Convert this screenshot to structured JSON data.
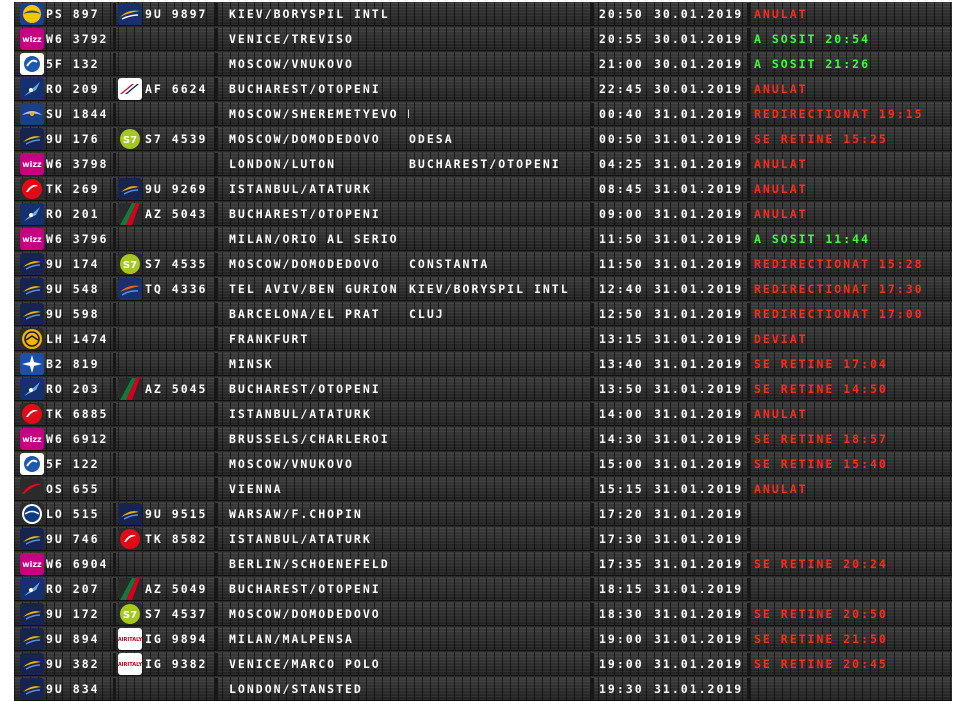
{
  "colors": {
    "board": "#2b2b2b",
    "text": "#ffffff",
    "delay": "#ff2a1a",
    "landed": "#3cff3c"
  },
  "flights": [
    {
      "airline_icon": "ukraine-intl-icon",
      "flight": "PS 897",
      "codeshare_icon": "windrose-icon",
      "codeshare": "9U 9897",
      "origin": "KIEV/BORYSPIL INTL",
      "via": "",
      "time": "20:50",
      "date": "30.01.2019",
      "status": "ANULAT",
      "status_color": "red"
    },
    {
      "airline_icon": "wizz-icon",
      "flight": "W6 3792",
      "codeshare_icon": "",
      "codeshare": "",
      "origin": "VENICE/TREVISO",
      "via": "",
      "time": "20:55",
      "date": "30.01.2019",
      "status": "A SOSIT 20:54",
      "status_color": "green"
    },
    {
      "airline_icon": "rossiya-icon",
      "flight": "5F 132",
      "codeshare_icon": "",
      "codeshare": "",
      "origin": "MOSCOW/VNUKOVO",
      "via": "",
      "time": "21:00",
      "date": "30.01.2019",
      "status": "A SOSIT 21:26",
      "status_color": "green"
    },
    {
      "airline_icon": "tarom-icon",
      "flight": "RO 209",
      "codeshare_icon": "airfrance-icon",
      "codeshare": "AF 6624",
      "origin": "BUCHAREST/OTOPENI",
      "via": "",
      "time": "22:45",
      "date": "30.01.2019",
      "status": "ANULAT",
      "status_color": "red"
    },
    {
      "airline_icon": "aeroflot-icon",
      "flight": "SU 1844",
      "codeshare_icon": "",
      "codeshare": "",
      "origin": "MOSCOW/SHEREMETYEVO BUDAPEST",
      "via": "",
      "time": "00:40",
      "date": "31.01.2019",
      "status": "REDIRECTIONAT 19:15",
      "status_color": "red"
    },
    {
      "airline_icon": "air-moldova-icon",
      "flight": "9U 176",
      "codeshare_icon": "s7-icon",
      "codeshare": "S7 4539",
      "origin": "MOSCOW/DOMODEDOVO",
      "via": "ODESA",
      "time": "00:50",
      "date": "31.01.2019",
      "status": "SE RETINE 15:25",
      "status_color": "red"
    },
    {
      "airline_icon": "wizz-icon",
      "flight": "W6 3798",
      "codeshare_icon": "",
      "codeshare": "",
      "origin": "LONDON/LUTON",
      "via": "BUCHAREST/OTOPENI",
      "time": "04:25",
      "date": "31.01.2019",
      "status": "ANULAT",
      "status_color": "red"
    },
    {
      "airline_icon": "turkish-icon",
      "flight": "TK 269",
      "codeshare_icon": "air-moldova-icon",
      "codeshare": "9U 9269",
      "origin": "ISTANBUL/ATATURK",
      "via": "",
      "time": "08:45",
      "date": "31.01.2019",
      "status": "ANULAT",
      "status_color": "red"
    },
    {
      "airline_icon": "tarom-icon",
      "flight": "RO 201",
      "codeshare_icon": "alitalia-icon",
      "codeshare": "AZ 5043",
      "origin": "BUCHAREST/OTOPENI",
      "via": "",
      "time": "09:00",
      "date": "31.01.2019",
      "status": "ANULAT",
      "status_color": "red"
    },
    {
      "airline_icon": "wizz-icon",
      "flight": "W6 3796",
      "codeshare_icon": "",
      "codeshare": "",
      "origin": "MILAN/ORIO AL SERIO",
      "via": "",
      "time": "11:50",
      "date": "31.01.2019",
      "status": "A SOSIT 11:44",
      "status_color": "green"
    },
    {
      "airline_icon": "air-moldova-icon",
      "flight": "9U 174",
      "codeshare_icon": "s7-icon",
      "codeshare": "S7 4535",
      "origin": "MOSCOW/DOMODEDOVO",
      "via": "CONSTANTA",
      "time": "11:50",
      "date": "31.01.2019",
      "status": "REDIRECTIONAT 15:28",
      "status_color": "red"
    },
    {
      "airline_icon": "air-moldova-icon",
      "flight": "9U 548",
      "codeshare_icon": "tq-icon",
      "codeshare": "TQ 4336",
      "origin": "TEL AVIV/BEN GURION",
      "via": "KIEV/BORYSPIL INTL",
      "time": "12:40",
      "date": "31.01.2019",
      "status": "REDIRECTIONAT 17:30",
      "status_color": "red"
    },
    {
      "airline_icon": "air-moldova-icon",
      "flight": "9U 598",
      "codeshare_icon": "",
      "codeshare": "",
      "origin": "BARCELONA/EL PRAT",
      "via": "CLUJ",
      "time": "12:50",
      "date": "31.01.2019",
      "status": "REDIRECTIONAT 17:00",
      "status_color": "red"
    },
    {
      "airline_icon": "lufthansa-icon",
      "flight": "LH 1474",
      "codeshare_icon": "",
      "codeshare": "",
      "origin": "FRANKFURT",
      "via": "",
      "time": "13:15",
      "date": "31.01.2019",
      "status": "DEVIAT",
      "status_color": "red"
    },
    {
      "airline_icon": "belavia-icon",
      "flight": "B2 819",
      "codeshare_icon": "",
      "codeshare": "",
      "origin": "MINSK",
      "via": "",
      "time": "13:40",
      "date": "31.01.2019",
      "status": "SE RETINE 17:04",
      "status_color": "red"
    },
    {
      "airline_icon": "tarom-icon",
      "flight": "RO 203",
      "codeshare_icon": "alitalia-icon",
      "codeshare": "AZ 5045",
      "origin": "BUCHAREST/OTOPENI",
      "via": "",
      "time": "13:50",
      "date": "31.01.2019",
      "status": "SE RETINE 14:50",
      "status_color": "red"
    },
    {
      "airline_icon": "turkish-icon",
      "flight": "TK 6885",
      "codeshare_icon": "",
      "codeshare": "",
      "origin": "ISTANBUL/ATATURK",
      "via": "",
      "time": "14:00",
      "date": "31.01.2019",
      "status": "ANULAT",
      "status_color": "red"
    },
    {
      "airline_icon": "wizz-icon",
      "flight": "W6 6912",
      "codeshare_icon": "",
      "codeshare": "",
      "origin": "BRUSSELS/CHARLEROI",
      "via": "",
      "time": "14:30",
      "date": "31.01.2019",
      "status": "SE RETINE 18:57",
      "status_color": "red"
    },
    {
      "airline_icon": "rossiya-icon",
      "flight": "5F 122",
      "codeshare_icon": "",
      "codeshare": "",
      "origin": "MOSCOW/VNUKOVO",
      "via": "",
      "time": "15:00",
      "date": "31.01.2019",
      "status": "SE RETINE 15:40",
      "status_color": "red"
    },
    {
      "airline_icon": "austrian-icon",
      "flight": "OS 655",
      "codeshare_icon": "",
      "codeshare": "",
      "origin": "VIENNA",
      "via": "",
      "time": "15:15",
      "date": "31.01.2019",
      "status": "ANULAT",
      "status_color": "red"
    },
    {
      "airline_icon": "lot-icon",
      "flight": "LO 515",
      "codeshare_icon": "air-moldova-icon",
      "codeshare": "9U 9515",
      "origin": "WARSAW/F.CHOPIN",
      "via": "",
      "time": "17:20",
      "date": "31.01.2019",
      "status": "",
      "status_color": "red"
    },
    {
      "airline_icon": "air-moldova-icon",
      "flight": "9U 746",
      "codeshare_icon": "turkish-icon",
      "codeshare": "TK 8582",
      "origin": "ISTANBUL/ATATURK",
      "via": "",
      "time": "17:30",
      "date": "31.01.2019",
      "status": "",
      "status_color": "red"
    },
    {
      "airline_icon": "wizz-icon",
      "flight": "W6 6904",
      "codeshare_icon": "",
      "codeshare": "",
      "origin": "BERLIN/SCHOENEFELD",
      "via": "",
      "time": "17:35",
      "date": "31.01.2019",
      "status": "SE RETINE 20:24",
      "status_color": "red"
    },
    {
      "airline_icon": "tarom-icon",
      "flight": "RO 207",
      "codeshare_icon": "alitalia-icon",
      "codeshare": "AZ 5049",
      "origin": "BUCHAREST/OTOPENI",
      "via": "",
      "time": "18:15",
      "date": "31.01.2019",
      "status": "",
      "status_color": "red"
    },
    {
      "airline_icon": "air-moldova-icon",
      "flight": "9U 172",
      "codeshare_icon": "s7-icon",
      "codeshare": "S7 4537",
      "origin": "MOSCOW/DOMODEDOVO",
      "via": "",
      "time": "18:30",
      "date": "31.01.2019",
      "status": "SE RETINE 20:50",
      "status_color": "red"
    },
    {
      "airline_icon": "air-moldova-icon",
      "flight": "9U 894",
      "codeshare_icon": "airitaly-icon",
      "codeshare": "IG 9894",
      "origin": "MILAN/MALPENSA",
      "via": "",
      "time": "19:00",
      "date": "31.01.2019",
      "status": "SE RETINE 21:50",
      "status_color": "red"
    },
    {
      "airline_icon": "air-moldova-icon",
      "flight": "9U 382",
      "codeshare_icon": "airitaly-icon",
      "codeshare": "IG 9382",
      "origin": "VENICE/MARCO POLO",
      "via": "",
      "time": "19:00",
      "date": "31.01.2019",
      "status": "SE RETINE 20:45",
      "status_color": "red"
    },
    {
      "airline_icon": "air-moldova-icon",
      "flight": "9U 834",
      "codeshare_icon": "",
      "codeshare": "",
      "origin": "LONDON/STANSTED",
      "via": "",
      "time": "19:30",
      "date": "31.01.2019",
      "status": "",
      "status_color": "red"
    }
  ]
}
